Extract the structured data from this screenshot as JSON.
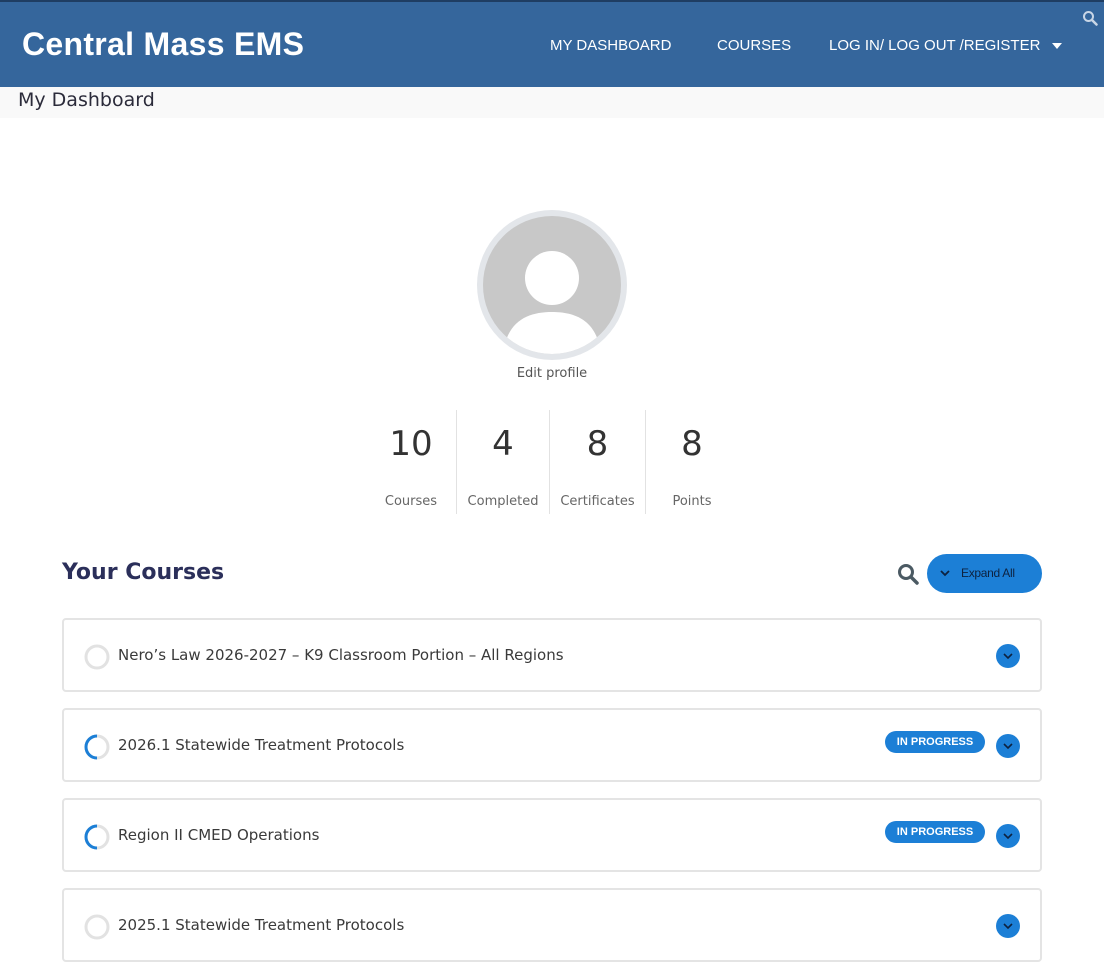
{
  "header": {
    "brand": "Central Mass EMS",
    "nav": {
      "dashboard": "MY DASHBOARD",
      "courses": "COURSES",
      "account": "LOG IN/ LOG OUT /REGISTER"
    }
  },
  "page": {
    "title": "My Dashboard"
  },
  "profile": {
    "edit_label": "Edit profile"
  },
  "stats": [
    {
      "value": "10",
      "label": "Courses"
    },
    {
      "value": "4",
      "label": "Completed"
    },
    {
      "value": "8",
      "label": "Certificates"
    },
    {
      "value": "8",
      "label": "Points"
    }
  ],
  "courses_section": {
    "title": "Your Courses",
    "expand_label": "Expand All"
  },
  "courses": [
    {
      "name": "Nero’s Law 2026-2027 – K9 Classroom Portion – All Regions",
      "status": "",
      "progress": 0
    },
    {
      "name": "2026.1 Statewide Treatment Protocols",
      "status": "IN PROGRESS",
      "progress": 0.25
    },
    {
      "name": "Region II CMED Operations",
      "status": "IN PROGRESS",
      "progress": 0.25
    },
    {
      "name": "2025.1 Statewide Treatment Protocols",
      "status": "",
      "progress": 0
    }
  ],
  "colors": {
    "header_bg": "#35669c",
    "accent": "#1c7fd6",
    "heading": "#2b2f5a"
  }
}
